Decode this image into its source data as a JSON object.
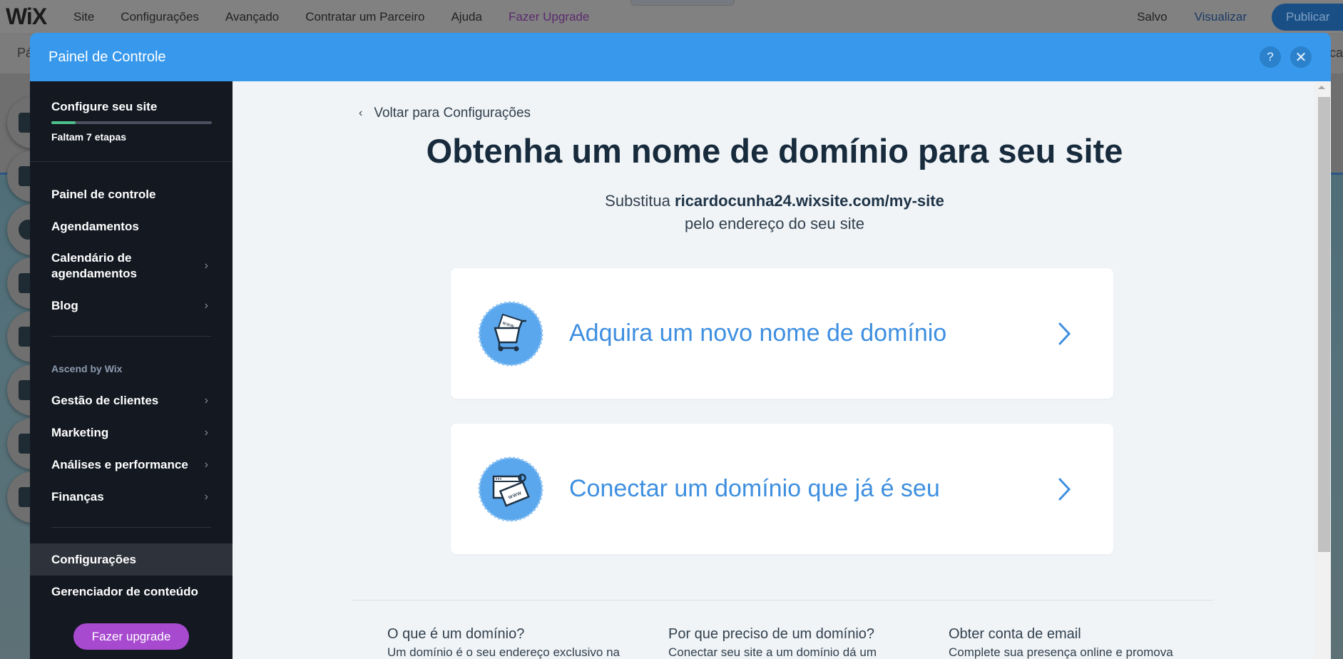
{
  "editor": {
    "logo": "WiX",
    "menu": [
      {
        "label": "Site"
      },
      {
        "label": "Configurações"
      },
      {
        "label": "Avançado"
      },
      {
        "label": "Contratar um Parceiro"
      },
      {
        "label": "Ajuda"
      },
      {
        "label": "Fazer Upgrade"
      }
    ],
    "saved_status": "Salvo",
    "preview_label": "Visualizar",
    "publish_label": "Publicar",
    "secondbar_left": "Pá",
    "secondbar_right": "ca"
  },
  "modal": {
    "title": "Painel de Controle",
    "help_icon": "?",
    "close_icon": "✕"
  },
  "sidebar": {
    "setup": {
      "title": "Configure seu site",
      "progress_percent": 15,
      "remaining": "Faltam 7 etapas"
    },
    "group1": [
      {
        "label": "Painel de controle",
        "has_chevron": false
      },
      {
        "label": "Agendamentos",
        "has_chevron": false
      },
      {
        "label": "Calendário de agendamentos",
        "has_chevron": true
      },
      {
        "label": "Blog",
        "has_chevron": true
      }
    ],
    "section_label": "Ascend by Wix",
    "group2": [
      {
        "label": "Gestão de clientes",
        "has_chevron": true
      },
      {
        "label": "Marketing",
        "has_chevron": true
      },
      {
        "label": "Análises e performance",
        "has_chevron": true
      },
      {
        "label": "Finanças",
        "has_chevron": true
      }
    ],
    "group3": [
      {
        "label": "Configurações",
        "active": true
      },
      {
        "label": "Gerenciador de conteúdo",
        "active": false
      }
    ],
    "upgrade_label": "Fazer upgrade",
    "chevron": "›"
  },
  "main": {
    "back_label": "Voltar para Configurações",
    "back_icon": "‹",
    "title": "Obtenha um nome de domínio para seu site",
    "subtitle_prefix": "Substitua",
    "subtitle_domain": "ricardocunha24.wixsite.com/my-site",
    "subtitle_line2": "pelo endereço do seu site",
    "cards": [
      {
        "label": "Adquira um novo nome de domínio",
        "icon": "shopping-cart-www-icon"
      },
      {
        "label": "Conectar um domínio que já é seu",
        "icon": "browser-www-tag-icon"
      }
    ],
    "faq": [
      {
        "title": "O que é um domínio?",
        "text": "Um domínio é o seu endereço exclusivo na"
      },
      {
        "title": "Por que preciso de um domínio?",
        "text": "Conectar seu site a um domínio dá um"
      },
      {
        "title": "Obter conta de email",
        "text": "Complete sua presença online e promova"
      }
    ]
  },
  "colors": {
    "header_blue": "#3899ec",
    "sidebar_bg": "#131821",
    "progress_green": "#4ec08a",
    "upgrade_purple": "#a74ad0",
    "link_blue": "#3e8fe0",
    "title_dark": "#172b3d"
  }
}
